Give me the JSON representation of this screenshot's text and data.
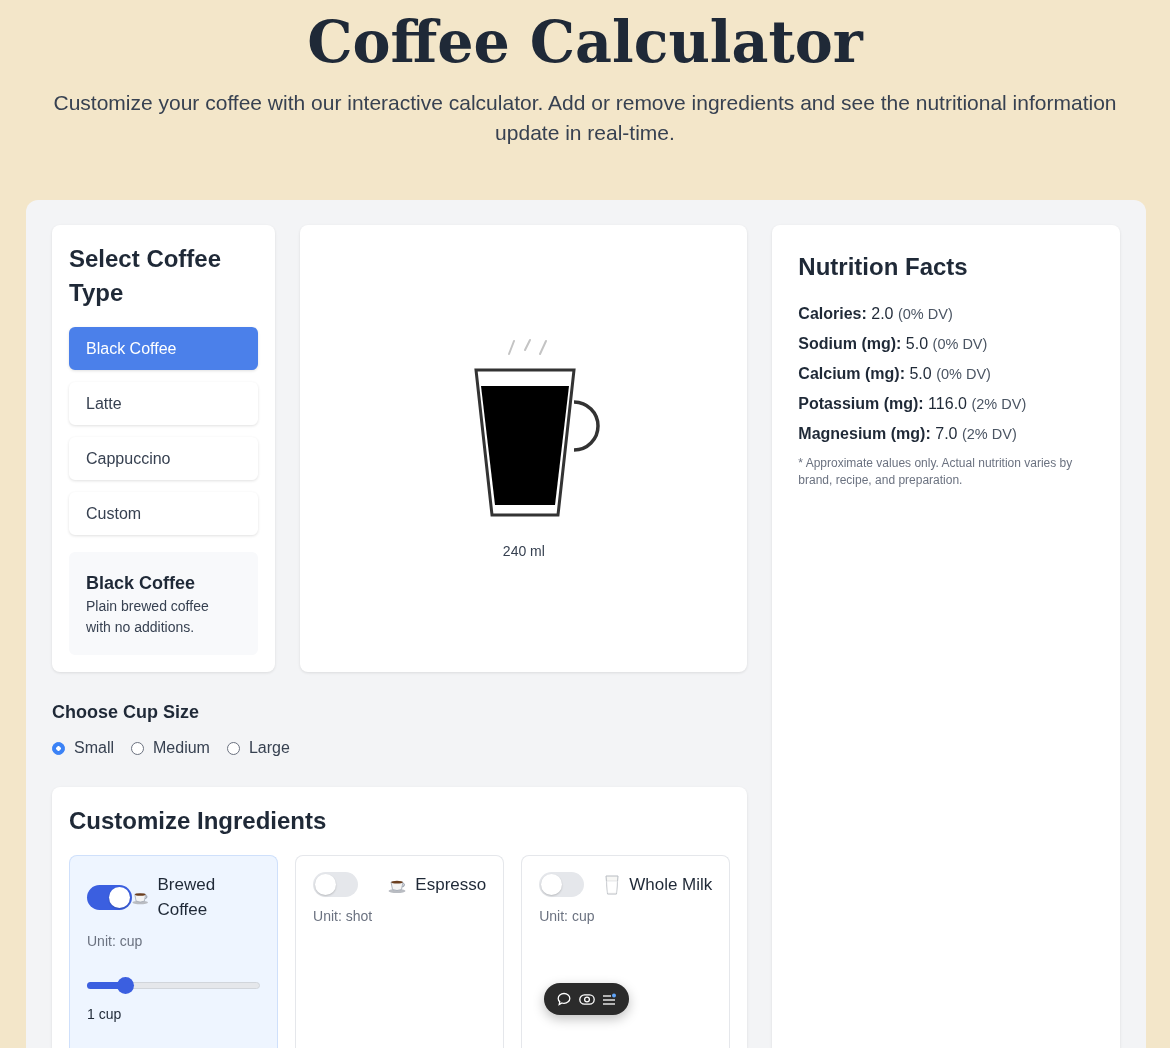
{
  "header": {
    "title": "Coffee Calculator",
    "subtitle": "Customize your coffee with our interactive calculator. Add or remove ingredients and see the nutritional information update in real-time."
  },
  "coffee_panel": {
    "title": "Select Coffee Type",
    "types": [
      {
        "label": "Black Coffee",
        "selected": true
      },
      {
        "label": "Latte",
        "selected": false
      },
      {
        "label": "Cappuccino",
        "selected": false
      },
      {
        "label": "Custom",
        "selected": false
      }
    ],
    "description": {
      "title": "Black Coffee",
      "text": "Plain brewed coffee with no additions."
    }
  },
  "cup_preview": {
    "volume": "240 ml"
  },
  "cup_size": {
    "title": "Choose Cup Size",
    "options": [
      {
        "label": "Small",
        "selected": true
      },
      {
        "label": "Medium",
        "selected": false
      },
      {
        "label": "Large",
        "selected": false
      }
    ]
  },
  "ingredients": {
    "title": "Customize Ingredients",
    "items": [
      {
        "name": "Brewed Coffee",
        "kind": "cup",
        "on": true,
        "unit": "Unit: cup",
        "level": 0.22,
        "amount": "1 cup"
      },
      {
        "name": "Espresso",
        "kind": "cup",
        "on": false,
        "unit": "Unit: shot"
      },
      {
        "name": "Whole Milk",
        "kind": "glass",
        "on": false,
        "unit": "Unit: cup"
      }
    ]
  },
  "nutrition": {
    "title": "Nutrition Facts",
    "rows": [
      {
        "label": "Calories:",
        "value": "2.0",
        "dv": "(0% DV)"
      },
      {
        "label": "Sodium (mg):",
        "value": "5.0",
        "dv": "(0% DV)"
      },
      {
        "label": "Calcium (mg):",
        "value": "5.0",
        "dv": "(0% DV)"
      },
      {
        "label": "Potassium (mg):",
        "value": "116.0",
        "dv": "(2% DV)"
      },
      {
        "label": "Magnesium (mg):",
        "value": "7.0",
        "dv": "(2% DV)"
      }
    ],
    "note": "* Approximate values only. Actual nutrition varies by brand, recipe, and preparation."
  }
}
